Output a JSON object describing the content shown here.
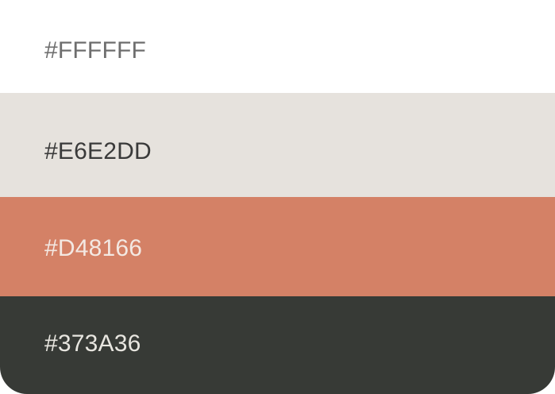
{
  "swatches": [
    {
      "hex": "#FFFFFF",
      "color": "#FFFFFF"
    },
    {
      "hex": "#E6E2DD",
      "color": "#E6E2DD"
    },
    {
      "hex": "#D48166",
      "color": "#D48166"
    },
    {
      "hex": "#373A36",
      "color": "#373A36"
    }
  ]
}
